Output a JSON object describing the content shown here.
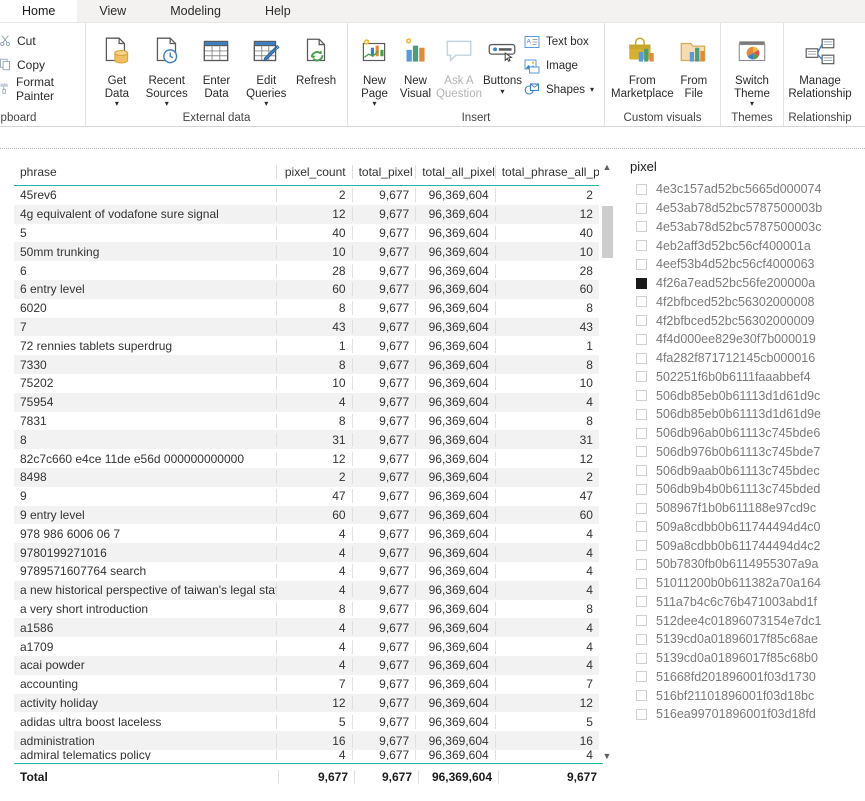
{
  "ribbon": {
    "tabs": [
      {
        "label": "Home",
        "active": true
      },
      {
        "label": "View",
        "active": false
      },
      {
        "label": "Modeling",
        "active": false
      },
      {
        "label": "Help",
        "active": false
      }
    ],
    "groups": {
      "clipboard": {
        "title": "ipboard",
        "items": [
          {
            "label": "Cut",
            "icon": "scissors-icon"
          },
          {
            "label": "Copy",
            "icon": "copy-icon"
          },
          {
            "label": "Format Painter",
            "icon": "format-painter-icon"
          }
        ]
      },
      "external_data": {
        "title": "External data",
        "items": [
          {
            "label": "Get\nData",
            "icon": "get-data-icon",
            "caret": true,
            "disabled": false
          },
          {
            "label": "Recent\nSources",
            "icon": "recent-sources-icon",
            "caret": true,
            "disabled": false
          },
          {
            "label": "Enter\nData",
            "icon": "enter-data-icon",
            "caret": false,
            "disabled": false
          },
          {
            "label": "Edit\nQueries",
            "icon": "edit-queries-icon",
            "caret": true,
            "disabled": false
          },
          {
            "label": "Refresh",
            "icon": "refresh-icon",
            "caret": false,
            "disabled": false
          }
        ]
      },
      "insert": {
        "title": "Insert",
        "items": [
          {
            "label": "New\nPage",
            "icon": "new-page-icon",
            "caret": true,
            "disabled": false
          },
          {
            "label": "New\nVisual",
            "icon": "new-visual-icon",
            "caret": false,
            "disabled": false
          },
          {
            "label": "Ask A\nQuestion",
            "icon": "ask-question-icon",
            "caret": false,
            "disabled": true
          },
          {
            "label": "Buttons",
            "icon": "buttons-icon",
            "caret": true,
            "disabled": false
          }
        ],
        "small_items": [
          {
            "label": "Text box",
            "icon": "text-box-icon",
            "caret": false
          },
          {
            "label": "Image",
            "icon": "image-icon",
            "caret": false
          },
          {
            "label": "Shapes",
            "icon": "shapes-icon",
            "caret": true
          }
        ]
      },
      "custom_visuals": {
        "title": "Custom visuals",
        "items": [
          {
            "label": "From\nMarketplace",
            "icon": "marketplace-icon",
            "caret": false,
            "disabled": false
          },
          {
            "label": "From\nFile",
            "icon": "from-file-icon",
            "caret": false,
            "disabled": false
          }
        ]
      },
      "themes": {
        "title": "Themes",
        "items": [
          {
            "label": "Switch\nTheme",
            "icon": "switch-theme-icon",
            "caret": true,
            "disabled": false
          }
        ]
      },
      "relationships": {
        "title": "Relationship",
        "items": [
          {
            "label": "Manage\nRelationship",
            "icon": "manage-relationships-icon",
            "caret": false,
            "disabled": false
          }
        ]
      }
    }
  },
  "table": {
    "columns": [
      "phrase",
      "pixel_count",
      "total_pixel",
      "total_all_pixel",
      "total_phrase_all_pixel"
    ],
    "rows": [
      {
        "phrase": "45rev6",
        "pixel_count": "2",
        "total_pixel": "9,677",
        "total_all_pixel": "96,369,604",
        "total_phrase_all_pixel": "2"
      },
      {
        "phrase": "4g equivalent of vodafone sure signal",
        "pixel_count": "12",
        "total_pixel": "9,677",
        "total_all_pixel": "96,369,604",
        "total_phrase_all_pixel": "12"
      },
      {
        "phrase": "5",
        "pixel_count": "40",
        "total_pixel": "9,677",
        "total_all_pixel": "96,369,604",
        "total_phrase_all_pixel": "40"
      },
      {
        "phrase": "50mm trunking",
        "pixel_count": "10",
        "total_pixel": "9,677",
        "total_all_pixel": "96,369,604",
        "total_phrase_all_pixel": "10"
      },
      {
        "phrase": "6",
        "pixel_count": "28",
        "total_pixel": "9,677",
        "total_all_pixel": "96,369,604",
        "total_phrase_all_pixel": "28"
      },
      {
        "phrase": "6 entry level",
        "pixel_count": "60",
        "total_pixel": "9,677",
        "total_all_pixel": "96,369,604",
        "total_phrase_all_pixel": "60"
      },
      {
        "phrase": "6020",
        "pixel_count": "8",
        "total_pixel": "9,677",
        "total_all_pixel": "96,369,604",
        "total_phrase_all_pixel": "8"
      },
      {
        "phrase": "7",
        "pixel_count": "43",
        "total_pixel": "9,677",
        "total_all_pixel": "96,369,604",
        "total_phrase_all_pixel": "43"
      },
      {
        "phrase": "72 rennies tablets superdrug",
        "pixel_count": "1",
        "total_pixel": "9,677",
        "total_all_pixel": "96,369,604",
        "total_phrase_all_pixel": "1"
      },
      {
        "phrase": "7330",
        "pixel_count": "8",
        "total_pixel": "9,677",
        "total_all_pixel": "96,369,604",
        "total_phrase_all_pixel": "8"
      },
      {
        "phrase": "75202",
        "pixel_count": "10",
        "total_pixel": "9,677",
        "total_all_pixel": "96,369,604",
        "total_phrase_all_pixel": "10"
      },
      {
        "phrase": "75954",
        "pixel_count": "4",
        "total_pixel": "9,677",
        "total_all_pixel": "96,369,604",
        "total_phrase_all_pixel": "4"
      },
      {
        "phrase": "7831",
        "pixel_count": "8",
        "total_pixel": "9,677",
        "total_all_pixel": "96,369,604",
        "total_phrase_all_pixel": "8"
      },
      {
        "phrase": "8",
        "pixel_count": "31",
        "total_pixel": "9,677",
        "total_all_pixel": "96,369,604",
        "total_phrase_all_pixel": "31"
      },
      {
        "phrase": "82c7c660 e4ce 11de e56d 000000000000",
        "pixel_count": "12",
        "total_pixel": "9,677",
        "total_all_pixel": "96,369,604",
        "total_phrase_all_pixel": "12"
      },
      {
        "phrase": "8498",
        "pixel_count": "2",
        "total_pixel": "9,677",
        "total_all_pixel": "96,369,604",
        "total_phrase_all_pixel": "2"
      },
      {
        "phrase": "9",
        "pixel_count": "47",
        "total_pixel": "9,677",
        "total_all_pixel": "96,369,604",
        "total_phrase_all_pixel": "47"
      },
      {
        "phrase": "9 entry level",
        "pixel_count": "60",
        "total_pixel": "9,677",
        "total_all_pixel": "96,369,604",
        "total_phrase_all_pixel": "60"
      },
      {
        "phrase": "978 986 6006 06 7",
        "pixel_count": "4",
        "total_pixel": "9,677",
        "total_all_pixel": "96,369,604",
        "total_phrase_all_pixel": "4"
      },
      {
        "phrase": "9780199271016",
        "pixel_count": "4",
        "total_pixel": "9,677",
        "total_all_pixel": "96,369,604",
        "total_phrase_all_pixel": "4"
      },
      {
        "phrase": "9789571607764 search",
        "pixel_count": "4",
        "total_pixel": "9,677",
        "total_all_pixel": "96,369,604",
        "total_phrase_all_pixel": "4"
      },
      {
        "phrase": "a new historical perspective of taiwan's legal status",
        "pixel_count": "4",
        "total_pixel": "9,677",
        "total_all_pixel": "96,369,604",
        "total_phrase_all_pixel": "4"
      },
      {
        "phrase": "a very short introduction",
        "pixel_count": "8",
        "total_pixel": "9,677",
        "total_all_pixel": "96,369,604",
        "total_phrase_all_pixel": "8"
      },
      {
        "phrase": "a1586",
        "pixel_count": "4",
        "total_pixel": "9,677",
        "total_all_pixel": "96,369,604",
        "total_phrase_all_pixel": "4"
      },
      {
        "phrase": "a1709",
        "pixel_count": "4",
        "total_pixel": "9,677",
        "total_all_pixel": "96,369,604",
        "total_phrase_all_pixel": "4"
      },
      {
        "phrase": "acai powder",
        "pixel_count": "4",
        "total_pixel": "9,677",
        "total_all_pixel": "96,369,604",
        "total_phrase_all_pixel": "4"
      },
      {
        "phrase": "accounting",
        "pixel_count": "7",
        "total_pixel": "9,677",
        "total_all_pixel": "96,369,604",
        "total_phrase_all_pixel": "7"
      },
      {
        "phrase": "activity holiday",
        "pixel_count": "12",
        "total_pixel": "9,677",
        "total_all_pixel": "96,369,604",
        "total_phrase_all_pixel": "12"
      },
      {
        "phrase": "adidas ultra boost laceless",
        "pixel_count": "5",
        "total_pixel": "9,677",
        "total_all_pixel": "96,369,604",
        "total_phrase_all_pixel": "5"
      },
      {
        "phrase": "administration",
        "pixel_count": "16",
        "total_pixel": "9,677",
        "total_all_pixel": "96,369,604",
        "total_phrase_all_pixel": "16"
      },
      {
        "phrase": "admiral telematics policy",
        "pixel_count": "4",
        "total_pixel": "9,677",
        "total_all_pixel": "96,369,604",
        "total_phrase_all_pixel": "4"
      }
    ],
    "total": {
      "phrase": "Total",
      "pixel_count": "9,677",
      "total_pixel": "9,677",
      "total_all_pixel": "96,369,604",
      "total_phrase_all_pixel": "9,677"
    }
  },
  "slicer": {
    "title": "pixel",
    "items": [
      {
        "label": "4e3c157ad52bc5665d000074",
        "checked": false
      },
      {
        "label": "4e53ab78d52bc5787500003b",
        "checked": false
      },
      {
        "label": "4e53ab78d52bc5787500003c",
        "checked": false
      },
      {
        "label": "4eb2aff3d52bc56cf400001a",
        "checked": false
      },
      {
        "label": "4eef53b4d52bc56cf4000063",
        "checked": false
      },
      {
        "label": "4f26a7ead52bc56fe200000a",
        "checked": true
      },
      {
        "label": "4f2bfbced52bc56302000008",
        "checked": false
      },
      {
        "label": "4f2bfbced52bc56302000009",
        "checked": false
      },
      {
        "label": "4f4d000ee829e30f7b000019",
        "checked": false
      },
      {
        "label": "4fa282f871712145cb000016",
        "checked": false
      },
      {
        "label": "502251f6b0b6111faaabbef4",
        "checked": false
      },
      {
        "label": "506db85eb0b61113d1d61d9c",
        "checked": false
      },
      {
        "label": "506db85eb0b61113d1d61d9e",
        "checked": false
      },
      {
        "label": "506db96ab0b61113c745bde6",
        "checked": false
      },
      {
        "label": "506db976b0b61113c745bde7",
        "checked": false
      },
      {
        "label": "506db9aab0b61113c745bdec",
        "checked": false
      },
      {
        "label": "506db9b4b0b61113c745bded",
        "checked": false
      },
      {
        "label": "508967f1b0b611188e97cd9c",
        "checked": false
      },
      {
        "label": "509a8cdbb0b611744494d4c0",
        "checked": false
      },
      {
        "label": "509a8cdbb0b611744494d4c2",
        "checked": false
      },
      {
        "label": "50b7830fb0b6114955307a9a",
        "checked": false
      },
      {
        "label": "51011200b0b611382a70a164",
        "checked": false
      },
      {
        "label": "511a7b4c6c76b471003abd1f",
        "checked": false
      },
      {
        "label": "512dee4c01896073154e7dc1",
        "checked": false
      },
      {
        "label": "5139cd0a01896017f85c68ae",
        "checked": false
      },
      {
        "label": "5139cd0a01896017f85c68b0",
        "checked": false
      },
      {
        "label": "51668fd201896001f03d1730",
        "checked": false
      },
      {
        "label": "516bf21101896001f03d18bc",
        "checked": false
      },
      {
        "label": "516ea99701896001f03d18fd",
        "checked": false
      }
    ]
  },
  "colors": {
    "accent_teal": "#1fb6ac",
    "ribbon_bg": "#ffffff",
    "tabstrip_bg": "#f3f2f1",
    "alt_row": "#f2f2f2"
  }
}
